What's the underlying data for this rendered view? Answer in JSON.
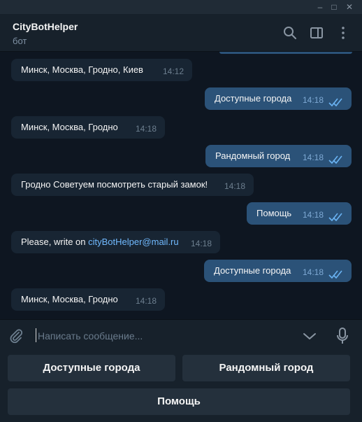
{
  "window": {
    "minimize_glyph": "–",
    "maximize_glyph": "□",
    "close_glyph": "✕"
  },
  "header": {
    "title": "CityBotHelper",
    "subtitle": "бот",
    "icons": [
      "search-icon",
      "sidebar-toggle-icon",
      "more-vertical-icon"
    ]
  },
  "messages": [
    {
      "direction": "in",
      "text": "Минск,  Москва,  Гродно,  Киев",
      "time": "14:12"
    },
    {
      "direction": "out",
      "text": "Доступные города",
      "time": "14:18",
      "status": "read"
    },
    {
      "direction": "in",
      "text": "Минск,  Москва,  Гродно",
      "time": "14:18"
    },
    {
      "direction": "out",
      "text": "Рандомный город",
      "time": "14:18",
      "status": "read"
    },
    {
      "direction": "in",
      "text": "Гродно Советуем посмотреть старый замок!",
      "time": "14:18"
    },
    {
      "direction": "out",
      "text": "Помощь",
      "time": "14:18",
      "status": "read"
    },
    {
      "direction": "in",
      "text_prefix": "Please, write on ",
      "link": "cityBotHelper@mail.ru",
      "time": "14:18"
    },
    {
      "direction": "out",
      "text": "Доступные города",
      "time": "14:18",
      "status": "read"
    },
    {
      "direction": "in",
      "text": "Минск,  Москва,  Гродно",
      "time": "14:18"
    }
  ],
  "composer": {
    "placeholder": "Написать сообщение...",
    "value": ""
  },
  "keyboard": {
    "available_cities": "Доступные города",
    "random_city": "Рандомный город",
    "help": "Помощь"
  },
  "colors": {
    "background": "#0e1621",
    "panel": "#17212b",
    "incoming_bubble": "#182533",
    "outgoing_bubble": "#2b5278",
    "link": "#71baff",
    "read_ticks": "#6ab3f3"
  }
}
